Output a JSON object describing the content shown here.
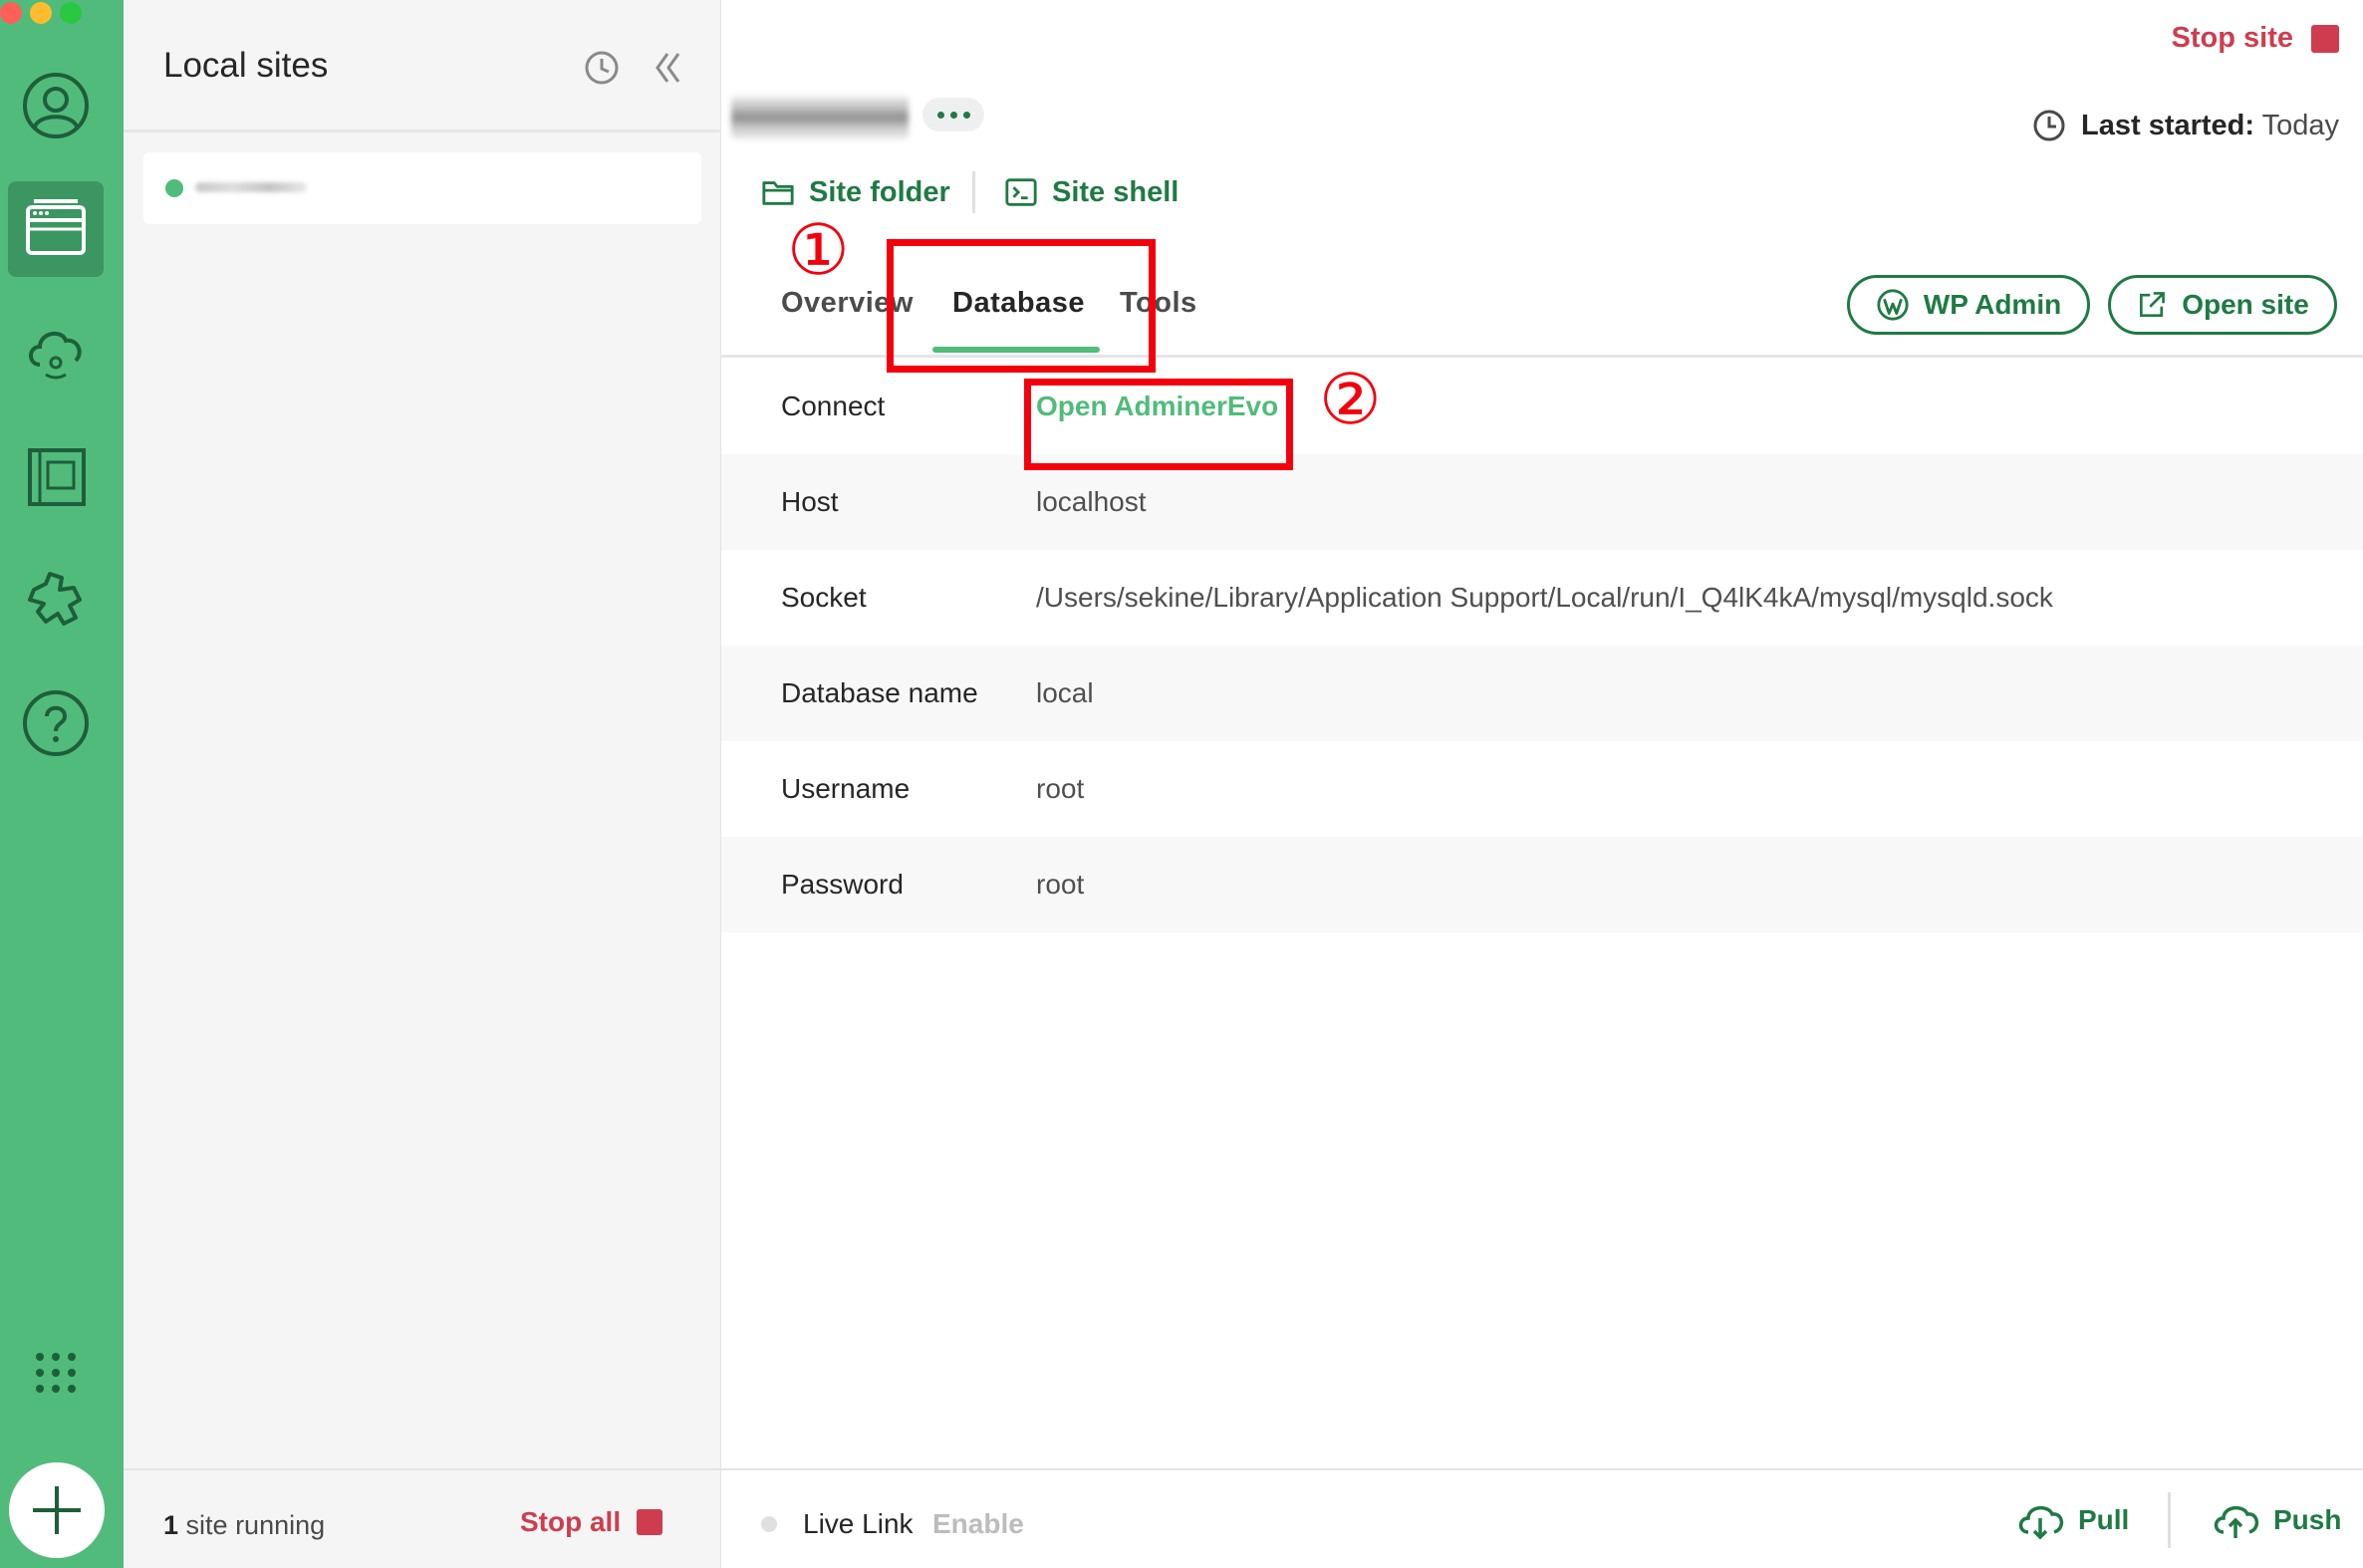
{
  "sidebar": {
    "title": "Local sites",
    "site_status": {
      "count": "1",
      "text": "site running"
    },
    "stop_all_label": "Stop all"
  },
  "header": {
    "stop_site_label": "Stop site",
    "last_started_label": "Last started:",
    "last_started_value": "Today",
    "actions": {
      "site_folder": "Site folder",
      "site_shell": "Site shell"
    }
  },
  "tabs": [
    "Overview",
    "Database",
    "Tools"
  ],
  "active_tab": "Database",
  "buttons": {
    "wp_admin": "WP Admin",
    "open_site": "Open site"
  },
  "database": {
    "rows": [
      {
        "label": "Connect",
        "value": "Open AdminerEvo",
        "is_link": true
      },
      {
        "label": "Host",
        "value": "localhost"
      },
      {
        "label": "Socket",
        "value": "/Users/sekine/Library/Application Support/Local/run/I_Q4lK4kA/mysql/mysqld.sock"
      },
      {
        "label": "Database name",
        "value": "local"
      },
      {
        "label": "Username",
        "value": "root"
      },
      {
        "label": "Password",
        "value": "root"
      }
    ]
  },
  "annotations": {
    "first": "①",
    "second": "②"
  },
  "footer": {
    "live_link_label": "Live Link",
    "live_link_action": "Enable",
    "pull_label": "Pull",
    "push_label": "Push"
  },
  "colors": {
    "brand_green": "#51bb7b",
    "dark_green": "#1f7a45",
    "stop_red": "#cf3c4f",
    "annotation_red": "#f4000d"
  },
  "icons": {
    "rail": [
      "user-icon",
      "sites-icon",
      "cloud-icon",
      "blueprint-icon",
      "addons-icon",
      "help-icon",
      "apps-grid-icon",
      "plus-icon"
    ],
    "sites_panel": [
      "history-icon",
      "collapse-icon"
    ],
    "header": [
      "clock-icon",
      "folder-icon",
      "terminal-icon",
      "wordpress-icon",
      "external-link-icon"
    ],
    "footer": [
      "cloud-download-icon",
      "cloud-upload-icon"
    ]
  }
}
